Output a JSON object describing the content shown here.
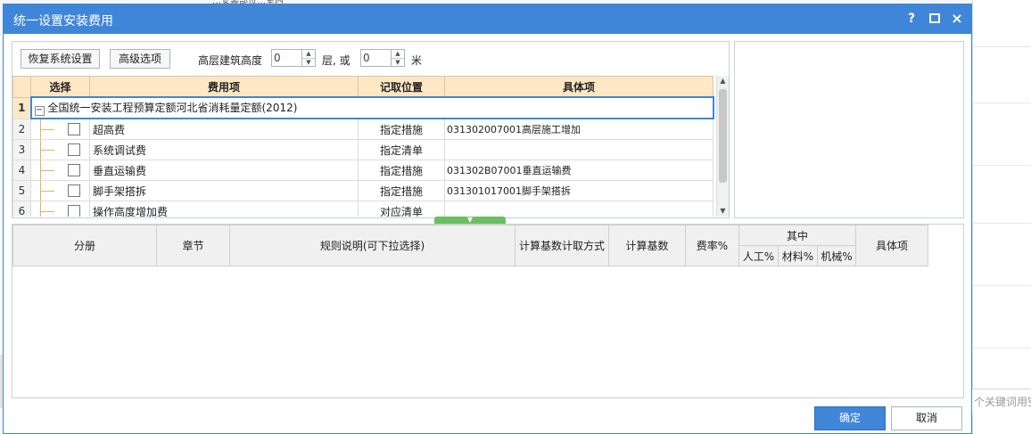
{
  "background": {
    "top_fragment": "…安装部位…室内",
    "search_placeholder": "个关键词用空"
  },
  "dialog": {
    "title": "统一设置安装费用",
    "help_label": "?",
    "close_label": "×"
  },
  "toolbar": {
    "restore_label": "恢复系统设置",
    "advanced_label": "高级选项",
    "height_label": "高层建筑高度",
    "floors_value": "0",
    "floors_unit": "层, 或",
    "meters_value": "0",
    "meters_unit": "米"
  },
  "fee_table": {
    "headers": [
      "选择",
      "费用项",
      "记取位置",
      "具体项"
    ],
    "group": {
      "row": "1",
      "name": "全国统一安装工程预算定额河北省消耗量定额(2012)",
      "expander": "−"
    },
    "rows": [
      {
        "row": "2",
        "name": "超高费",
        "position": "指定措施",
        "item": "031302007001高层施工增加"
      },
      {
        "row": "3",
        "name": "系统调试费",
        "position": "指定清单",
        "item": ""
      },
      {
        "row": "4",
        "name": "垂直运输费",
        "position": "指定措施",
        "item": "031302B07001垂直运输费"
      },
      {
        "row": "5",
        "name": "脚手架搭拆",
        "position": "指定措施",
        "item": "031301017001脚手架搭拆"
      },
      {
        "row": "6",
        "name": "操作高度增加费",
        "position": "对应清单",
        "item": ""
      }
    ]
  },
  "rule_table": {
    "headers": {
      "volume": "分册",
      "chapter": "章节",
      "rule": "规则说明(可下拉选择)",
      "calc_method": "计算基数计取方式",
      "calc_base": "计算基数",
      "rate": "费率%",
      "of_which": "其中",
      "labor": "人工%",
      "material": "材料%",
      "machine": "机械%",
      "item": "具体项"
    }
  },
  "footer": {
    "ok_label": "确定",
    "cancel_label": "取消"
  },
  "colors": {
    "accent": "#3f86d8",
    "header_bg": "#fde7c4",
    "splitter": "#6abf60"
  }
}
